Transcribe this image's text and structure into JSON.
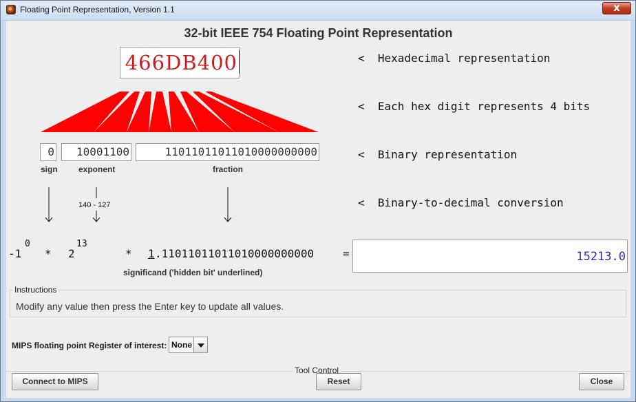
{
  "window": {
    "title": "Floating Point Representation, Version 1.1",
    "close_glyph": "x"
  },
  "main": {
    "title": "32-bit IEEE 754 Floating Point Representation",
    "hexadecimal": "466DB400",
    "binary": {
      "sign": "0",
      "exponent": "10001100",
      "fraction": "11011011011010000000000"
    },
    "labels": {
      "sign": "sign",
      "exponent": "exponent",
      "fraction": "fraction",
      "significand": "significand ('hidden bit' underlined)"
    },
    "descriptions": {
      "hexadecimal": "<  Hexadecimal representation",
      "hex_digit": "<  Each hex digit represents 4 bits",
      "binary": "<  Binary representation",
      "conversion": "<  Binary-to-decimal conversion"
    },
    "formula": {
      "minus_one": "-1",
      "sign_power": "0",
      "multiply_one": "*",
      "two": "2",
      "exponent_power": "13",
      "multiply_two": "*",
      "hidden_bit": "1",
      "fraction_part": ".11011011011010000000000",
      "equals": "="
    },
    "exponent_calculation": "140 - 127",
    "decimal_value": "15213.0"
  },
  "instructions": {
    "legend": "Instructions",
    "text": "Modify any value then press the Enter key to update all values."
  },
  "register": {
    "label": "MIPS floating point Register of interest:",
    "selected": "None",
    "dropdown_icon": "chevron-down-icon"
  },
  "tool_control": {
    "legend": "Tool Control",
    "connect": "Connect to MIPS",
    "reset": "Reset",
    "close": "Close"
  },
  "colors": {
    "hex_text": "#cc1c1c",
    "fan": "#ff0000",
    "decimal_text": "#2832b5",
    "title_bar": "#cddff3"
  }
}
